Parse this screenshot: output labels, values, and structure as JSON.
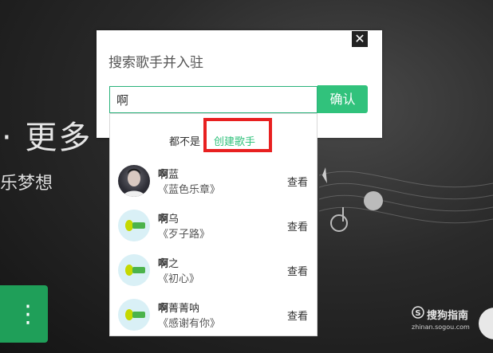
{
  "background": {
    "headline": "· 更多",
    "subline": "乐梦想",
    "green_button_glyph": "⋮",
    "watermark_brand": "搜狗指南",
    "watermark_url": "zhinan.sogou.com"
  },
  "dialog": {
    "title": "搜索歌手并入驻",
    "close_symbol": "✕",
    "search_value": "啊",
    "confirm_label": "确认",
    "none_label": "都不是",
    "create_label": "创建歌手",
    "highlight_color": "#e82020",
    "accent_color": "#31c27c"
  },
  "results": [
    {
      "name_bold": "啊",
      "name_rest": "蓝",
      "album": "《蓝色乐章》",
      "view": "查看",
      "avatar": "photo"
    },
    {
      "name_bold": "啊",
      "name_rest": "乌",
      "album": "《歹子路》",
      "view": "查看",
      "avatar": "qq-music-logo"
    },
    {
      "name_bold": "啊",
      "name_rest": "之",
      "album": "《初心》",
      "view": "查看",
      "avatar": "qq-music-logo"
    },
    {
      "name_bold": "啊",
      "name_rest": "菁菁呐",
      "album": "《感谢有你》",
      "view": "查看",
      "avatar": "qq-music-logo"
    }
  ]
}
